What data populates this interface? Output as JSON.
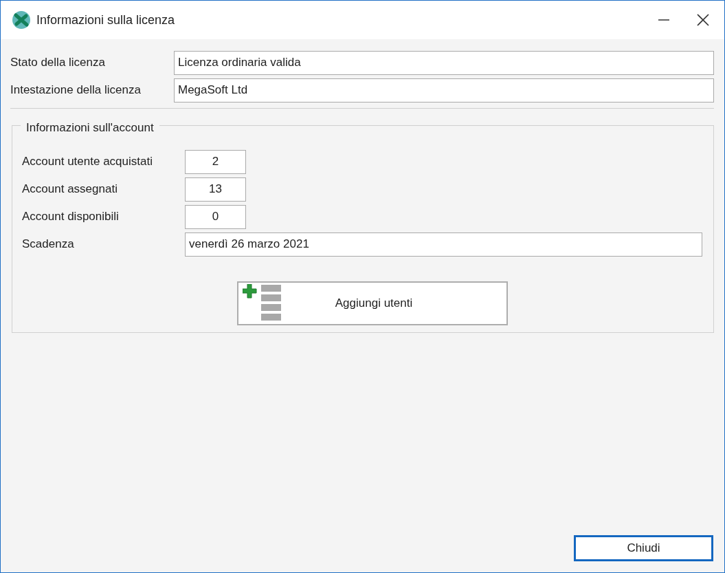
{
  "window": {
    "title": "Informazioni sulla licenza"
  },
  "license_fields": [
    {
      "label": "Stato della licenza",
      "value": "Licenza ordinaria valida"
    },
    {
      "label": "Intestazione della licenza",
      "value": "MegaSoft Ltd"
    }
  ],
  "account_group": {
    "title": "Informazioni sull'account",
    "fields": [
      {
        "label": "Account utente acquistati",
        "value": "2",
        "kind": "short"
      },
      {
        "label": "Account assegnati",
        "value": "13",
        "kind": "short"
      },
      {
        "label": "Account disponibili",
        "value": "0",
        "kind": "short"
      },
      {
        "label": "Scadenza",
        "value": "venerdì 26 marzo 2021",
        "kind": "wide"
      }
    ],
    "add_button": "Aggiungi utenti"
  },
  "close_button": "Chiudi"
}
